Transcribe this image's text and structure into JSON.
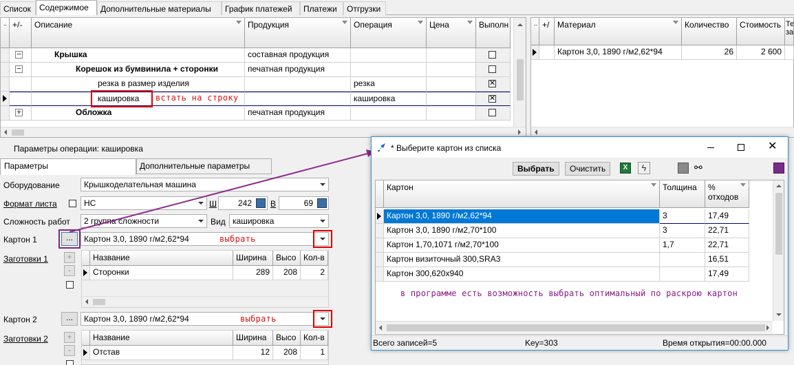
{
  "tabs": [
    "Список",
    "Содержимое",
    "Дополнительные материалы",
    "График платежей",
    "Платежи",
    "Отгрузки"
  ],
  "main_grid": {
    "headers": [
      "+/-",
      "Описание",
      "Продукция",
      "Операция",
      "Цена",
      "Выполн"
    ],
    "rows": [
      {
        "desc": "Крышка",
        "product": "составная продукция",
        "op": "",
        "checked": false
      },
      {
        "desc": "Корешок из бумвинила + сторонки",
        "product": "печатная продукция",
        "op": "",
        "checked": false
      },
      {
        "desc": "резка в размер изделия",
        "product": "",
        "op": "резка",
        "checked": true
      },
      {
        "desc": "кашировка",
        "product": "",
        "op": "кашировка",
        "checked": true
      },
      {
        "desc": "Обложка",
        "product": "печатная продукция",
        "op": "",
        "checked": false
      }
    ],
    "annotation": "встать на строку"
  },
  "material_grid": {
    "headers": [
      "+/",
      "Материал",
      "Количество",
      "Стоимость",
      "Те за"
    ],
    "rows": [
      {
        "name": "Картон 3,0, 1890 г/м2,62*94",
        "qty": "26",
        "cost": "2 600"
      }
    ]
  },
  "params": {
    "title": "Параметры операции: кашировка",
    "tab_params": "Параметры",
    "tab_extra": "Дополнительные параметры",
    "equipment_label": "Оборудование",
    "equipment_value": "Крышкоделательная машина",
    "format_label": "Формат листа",
    "format_value": "НС",
    "w_label": "Ш",
    "w_value": "242",
    "h_label": "В",
    "h_value": "69",
    "complexity_label": "Сложность работ",
    "complexity_value": "2 группа сложности",
    "kind_label": "Вид",
    "kind_value": "кашировка",
    "carton1_label": "Картон 1",
    "carton1_value": "Картон 3,0, 1890 г/м2,62*94",
    "choose_label": "выбрать",
    "blanks1_label": "Заготовки 1",
    "carton2_label": "Картон 2",
    "carton2_value": "Картон 3,0, 1890 г/м2,62*94",
    "blanks2_label": "Заготовки 2",
    "dots": "...",
    "plus": "+",
    "minus": "-",
    "blank_headers": [
      "Название",
      "Ширина",
      "Высо",
      "Кол-в"
    ],
    "blanks1": [
      {
        "name": "Сторонки",
        "w": "289",
        "h": "208",
        "qty": "2"
      }
    ],
    "blanks2": [
      {
        "name": "Отстав",
        "w": "12",
        "h": "208",
        "qty": "1"
      }
    ]
  },
  "dialog": {
    "title": "* Выберите картон из списка",
    "btn_choose": "Выбрать",
    "btn_clear": "Очистить",
    "headers": [
      "Картон",
      "Толщина",
      "% отходов"
    ],
    "rows": [
      {
        "name": "Картон 3,0, 1890 г/м2,62*94",
        "thick": "3",
        "waste": "17,49"
      },
      {
        "name": "Картон 3,0, 1890 г/м2,70*100",
        "thick": "3",
        "waste": "22,71"
      },
      {
        "name": "Картон 1,70,1071 г/м2,70*100",
        "thick": "1,7",
        "waste": "22,71"
      },
      {
        "name": "Картон визиточный 300,SRA3",
        "thick": "",
        "waste": "16,51"
      },
      {
        "name": "Картон 300,620x940",
        "thick": "",
        "waste": "17,49"
      }
    ],
    "note": "в программе есть возможность выбрать оптимальный по раскрою картон",
    "status_total": "Всего записей=5",
    "status_key": "Key=303",
    "status_time": "Время открытия=00:00.000"
  },
  "colors": {
    "selection": "#0078d7",
    "annotation_red": "#e01010",
    "note_purple": "#8b1a8b",
    "arrow_purple": "#8b2a8b"
  }
}
